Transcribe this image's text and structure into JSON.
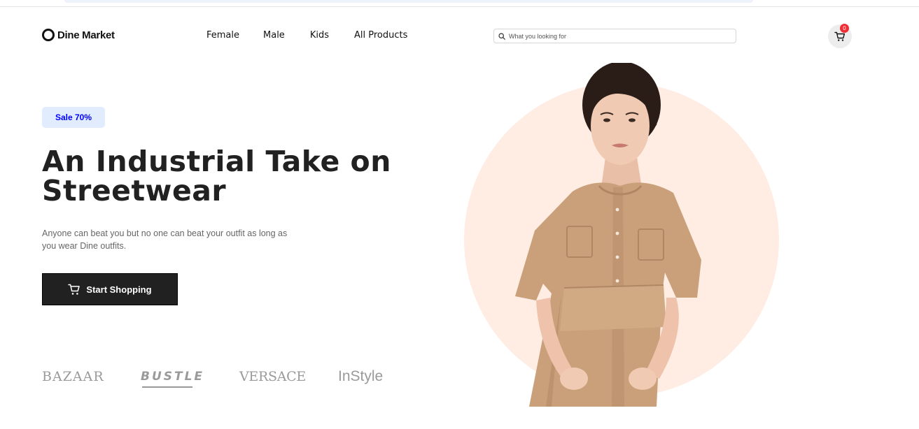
{
  "header": {
    "logo_text": "Dine Market",
    "nav": [
      "Female",
      "Male",
      "Kids",
      "All Products"
    ],
    "search_placeholder": "What you looking for",
    "cart_count": "0"
  },
  "hero": {
    "badge": "Sale 70%",
    "title_line1": "An Industrial Take on",
    "title_line2": "Streetwear",
    "description_line1": "Anyone can beat you but no one can beat your outfit as long as",
    "description_line2": "you wear Dine outfits.",
    "cta_label": "Start Shopping",
    "brands": [
      "BAZAAR",
      "BUSTLE",
      "VERSACE",
      "InStyle"
    ]
  },
  "colors": {
    "text": "#212121",
    "accent_badge_bg": "#e1edff",
    "accent_badge_text": "#0000ff",
    "hero_circle": "#ffece3",
    "cart_badge": "#f02d34",
    "cta_bg": "#212121"
  },
  "icons": {
    "logo": "ring-logo-icon",
    "search": "search-icon",
    "cart": "cart-icon"
  }
}
